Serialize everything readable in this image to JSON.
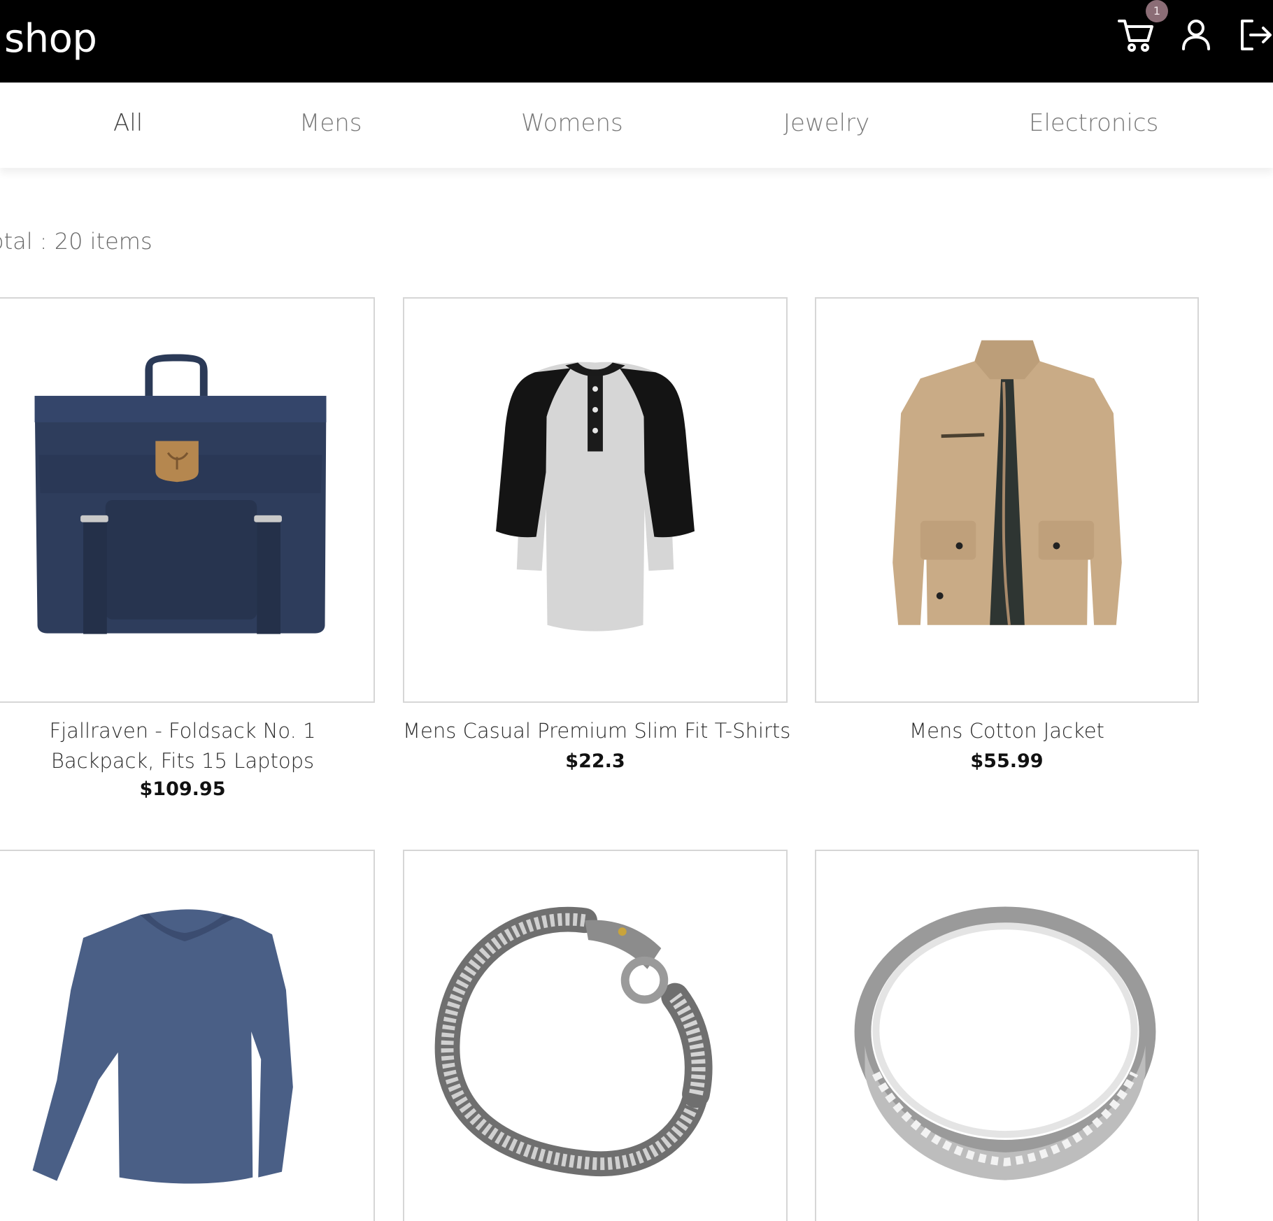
{
  "header": {
    "brand": "shop",
    "cart_count": "1",
    "icons": [
      "cart-icon",
      "user-icon",
      "logout-icon"
    ]
  },
  "categories": [
    "All",
    "Mens",
    "Womens",
    "Jewelry",
    "Electronics"
  ],
  "active_category": "All",
  "summary": {
    "total_text": "otal : 20 items"
  },
  "products": [
    {
      "title": "Fjallraven - Foldsack No. 1 Backpack, Fits 15 Laptops",
      "price": "$109.95",
      "image": "backpack"
    },
    {
      "title": "Mens Casual Premium Slim Fit T-Shirts",
      "price": "$22.3",
      "image": "raglan-tshirt"
    },
    {
      "title": "Mens Cotton Jacket",
      "price": "$55.99",
      "image": "khaki-jacket"
    },
    {
      "image": "blue-longsleeve-shirt"
    },
    {
      "image": "silver-dragon-bracelet"
    },
    {
      "image": "silver-ring"
    }
  ],
  "colors": {
    "header_bg": "#000000",
    "badge_bg": "#8b6d76",
    "card_border": "#d6d6d6"
  }
}
